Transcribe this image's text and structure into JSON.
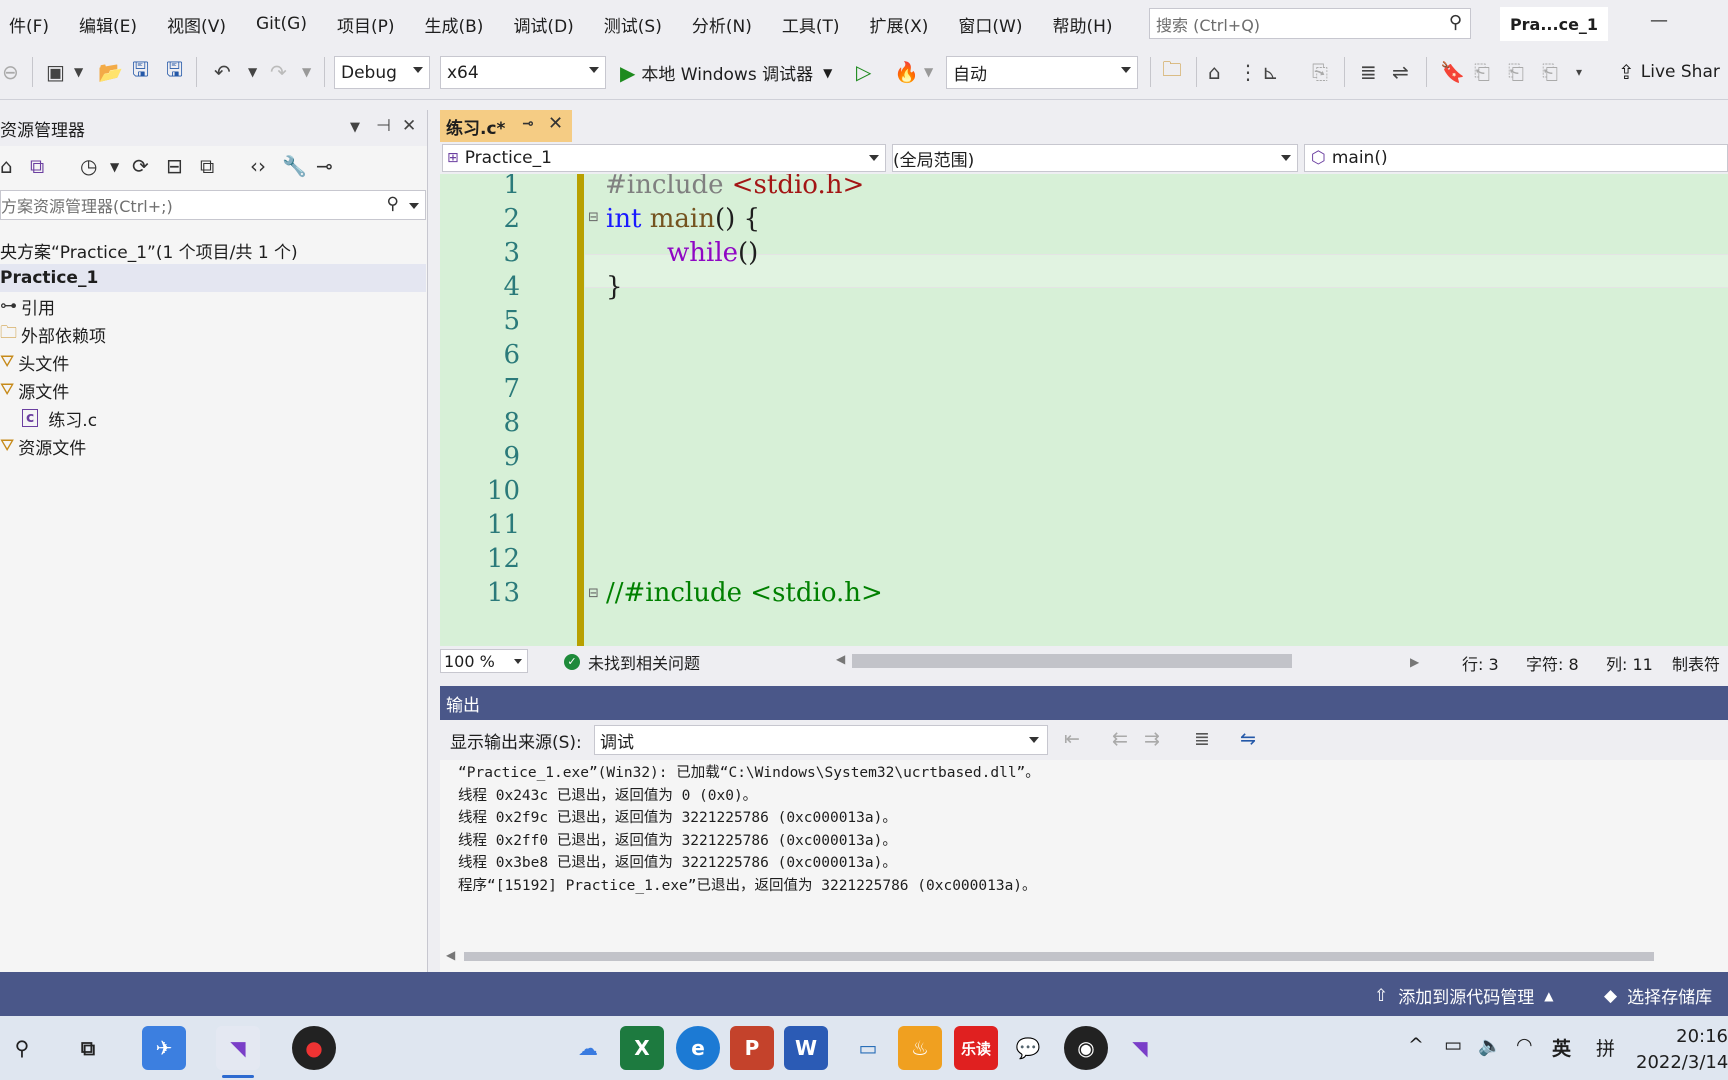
{
  "menu": [
    "件(F)",
    "编辑(E)",
    "视图(V)",
    "Git(G)",
    "项目(P)",
    "生成(B)",
    "调试(D)",
    "测试(S)",
    "分析(N)",
    "工具(T)",
    "扩展(X)",
    "窗口(W)",
    "帮助(H)"
  ],
  "search": {
    "placeholder": "搜索 (Ctrl+Q)"
  },
  "solution_chip": "Pra...ce_1",
  "toolbar": {
    "config": "Debug",
    "platform": "x64",
    "run_label": "本地 Windows 调试器",
    "auto_label": "自动",
    "live_share": "Live Shar"
  },
  "solution_explorer": {
    "title": "资源管理器",
    "search_placeholder": "方案资源管理器(Ctrl+;)",
    "items": [
      {
        "label": "央方案“Practice_1”(1 个项目/共 1 个)"
      },
      {
        "label": "Practice_1"
      },
      {
        "label": "引用"
      },
      {
        "label": "外部依赖项"
      },
      {
        "label": "头文件"
      },
      {
        "label": "源文件"
      },
      {
        "label": "练习.c"
      },
      {
        "label": "资源文件"
      }
    ]
  },
  "editor": {
    "tab_label": "练习.c*",
    "nav_project": "Practice_1",
    "nav_scope": "(全局范围)",
    "nav_member": "main()",
    "line_numbers": [
      "1",
      "2",
      "3",
      "4",
      "5",
      "6",
      "7",
      "8",
      "9",
      "10",
      "11",
      "12",
      "13"
    ],
    "code": {
      "l1_directive": "#include",
      "l1_header": " <stdio.h>",
      "l2_kw": "int",
      "l2_fn": " main",
      "l2_rest": "() {",
      "l3_fn": "while",
      "l3_rest": "()",
      "l4": "}",
      "l13": "//#include <stdio.h>"
    },
    "zoom": "100 %",
    "issues": "未找到相关问题",
    "row": "行: 3",
    "char": "字符: 8",
    "col": "列: 11",
    "tabs_mode": "制表符"
  },
  "output": {
    "title": "输出",
    "source_label": "显示输出来源(S):",
    "source_value": "调试",
    "lines": [
      "“Practice_1.exe”(Win32): 已加载“C:\\Windows\\System32\\ucrtbased.dll”。",
      "线程 0x243c 已退出，返回值为 0 (0x0)。",
      "线程 0x2f9c 已退出，返回值为 3221225786 (0xc000013a)。",
      "线程 0x2ff0 已退出，返回值为 3221225786 (0xc000013a)。",
      "线程 0x3be8 已退出，返回值为 3221225786 (0xc000013a)。",
      "程序“[15192] Practice_1.exe”已退出，返回值为 3221225786 (0xc000013a)。"
    ]
  },
  "status_bar": {
    "source_control": "添加到源代码管理",
    "repo": "选择存储库"
  },
  "taskbar": {
    "ime": "英",
    "ime2": "拼",
    "time": "20:16",
    "date": "2022/3/14"
  },
  "colors": {
    "editor_bg": "#d7f0d7",
    "status_bar": "#4a5789",
    "tab_active": "#f5cc84"
  }
}
